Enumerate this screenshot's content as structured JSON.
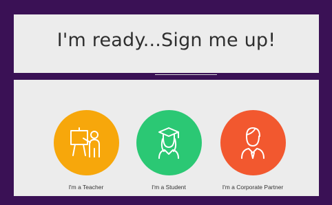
{
  "header": {
    "title": "I'm ready...Sign me up!"
  },
  "options": [
    {
      "label": "I'm a Teacher",
      "color": "#f7a70b",
      "icon": "teacher-icon"
    },
    {
      "label": "I'm a Student",
      "color": "#2bc874",
      "icon": "student-icon"
    },
    {
      "label": "I'm a Corporate Partner",
      "color": "#f2582f",
      "icon": "corporate-partner-icon"
    }
  ],
  "colors": {
    "frame": "#3a1155",
    "panel": "#ececec",
    "text": "#2f2f2f"
  }
}
